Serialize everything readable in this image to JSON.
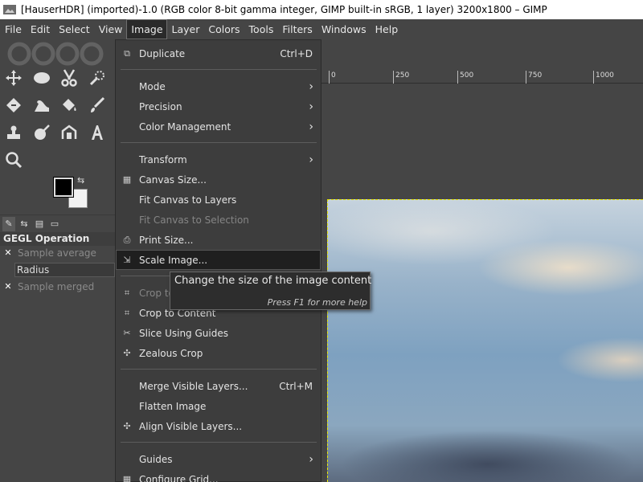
{
  "window": {
    "title": "[HauserHDR] (imported)-1.0 (RGB color 8-bit gamma integer, GIMP built-in sRGB, 1 layer) 3200x1800 – GIMP"
  },
  "menubar": {
    "items": [
      {
        "label": "File"
      },
      {
        "label": "Edit"
      },
      {
        "label": "Select"
      },
      {
        "label": "View"
      },
      {
        "label": "Image",
        "active": true
      },
      {
        "label": "Layer"
      },
      {
        "label": "Colors"
      },
      {
        "label": "Tools"
      },
      {
        "label": "Filters"
      },
      {
        "label": "Windows"
      },
      {
        "label": "Help"
      }
    ]
  },
  "image_menu": {
    "duplicate": {
      "label": "Duplicate",
      "shortcut": "Ctrl+D",
      "icon": "duplicate-icon"
    },
    "mode": {
      "label": "Mode"
    },
    "precision": {
      "label": "Precision"
    },
    "color_management": {
      "label": "Color Management"
    },
    "transform": {
      "label": "Transform"
    },
    "canvas_size": {
      "label": "Canvas Size...",
      "icon": "canvas-size-icon"
    },
    "fit_canvas_layers": {
      "label": "Fit Canvas to Layers"
    },
    "fit_canvas_selection": {
      "label": "Fit Canvas to Selection",
      "disabled": true
    },
    "print_size": {
      "label": "Print Size...",
      "icon": "printer-icon"
    },
    "scale_image": {
      "label": "Scale Image...",
      "icon": "scale-icon",
      "highlighted": true
    },
    "crop_to": {
      "label": "Crop to",
      "disabled": true,
      "icon": "crop-icon"
    },
    "crop_to_content": {
      "label": "Crop to Content",
      "icon": "crop-icon"
    },
    "slice_guides": {
      "label": "Slice Using Guides",
      "icon": "slice-icon"
    },
    "zealous_crop": {
      "label": "Zealous Crop",
      "icon": "zealous-crop-icon"
    },
    "merge_visible": {
      "label": "Merge Visible Layers...",
      "shortcut": "Ctrl+M"
    },
    "flatten": {
      "label": "Flatten Image"
    },
    "align_visible": {
      "label": "Align Visible Layers...",
      "icon": "align-icon"
    },
    "guides": {
      "label": "Guides"
    },
    "configure_grid": {
      "label": "Configure Grid...",
      "icon": "grid-icon"
    }
  },
  "tooltip": {
    "text": "Change the size of the image content",
    "hint": "Press F1 for more help"
  },
  "toolbox": {
    "tools": [
      "move-icon",
      "ellipse-select-icon",
      "scissors-icon",
      "fuzzy-select-icon",
      "transform-icon",
      "warp-icon",
      "bucket-fill-icon",
      "paintbrush-icon",
      "clone-icon",
      "smudge-icon",
      "paths-icon",
      "text-icon",
      "zoom-icon"
    ],
    "fg_color": "#000000",
    "bg_color": "#f2f2f2"
  },
  "tool_options": {
    "title": "GEGL Operation",
    "sample_average": "Sample average",
    "radius_label": "Radius",
    "sample_merged": "Sample merged"
  },
  "ruler": {
    "labels": [
      "0",
      "250",
      "500",
      "750",
      "1000"
    ]
  }
}
